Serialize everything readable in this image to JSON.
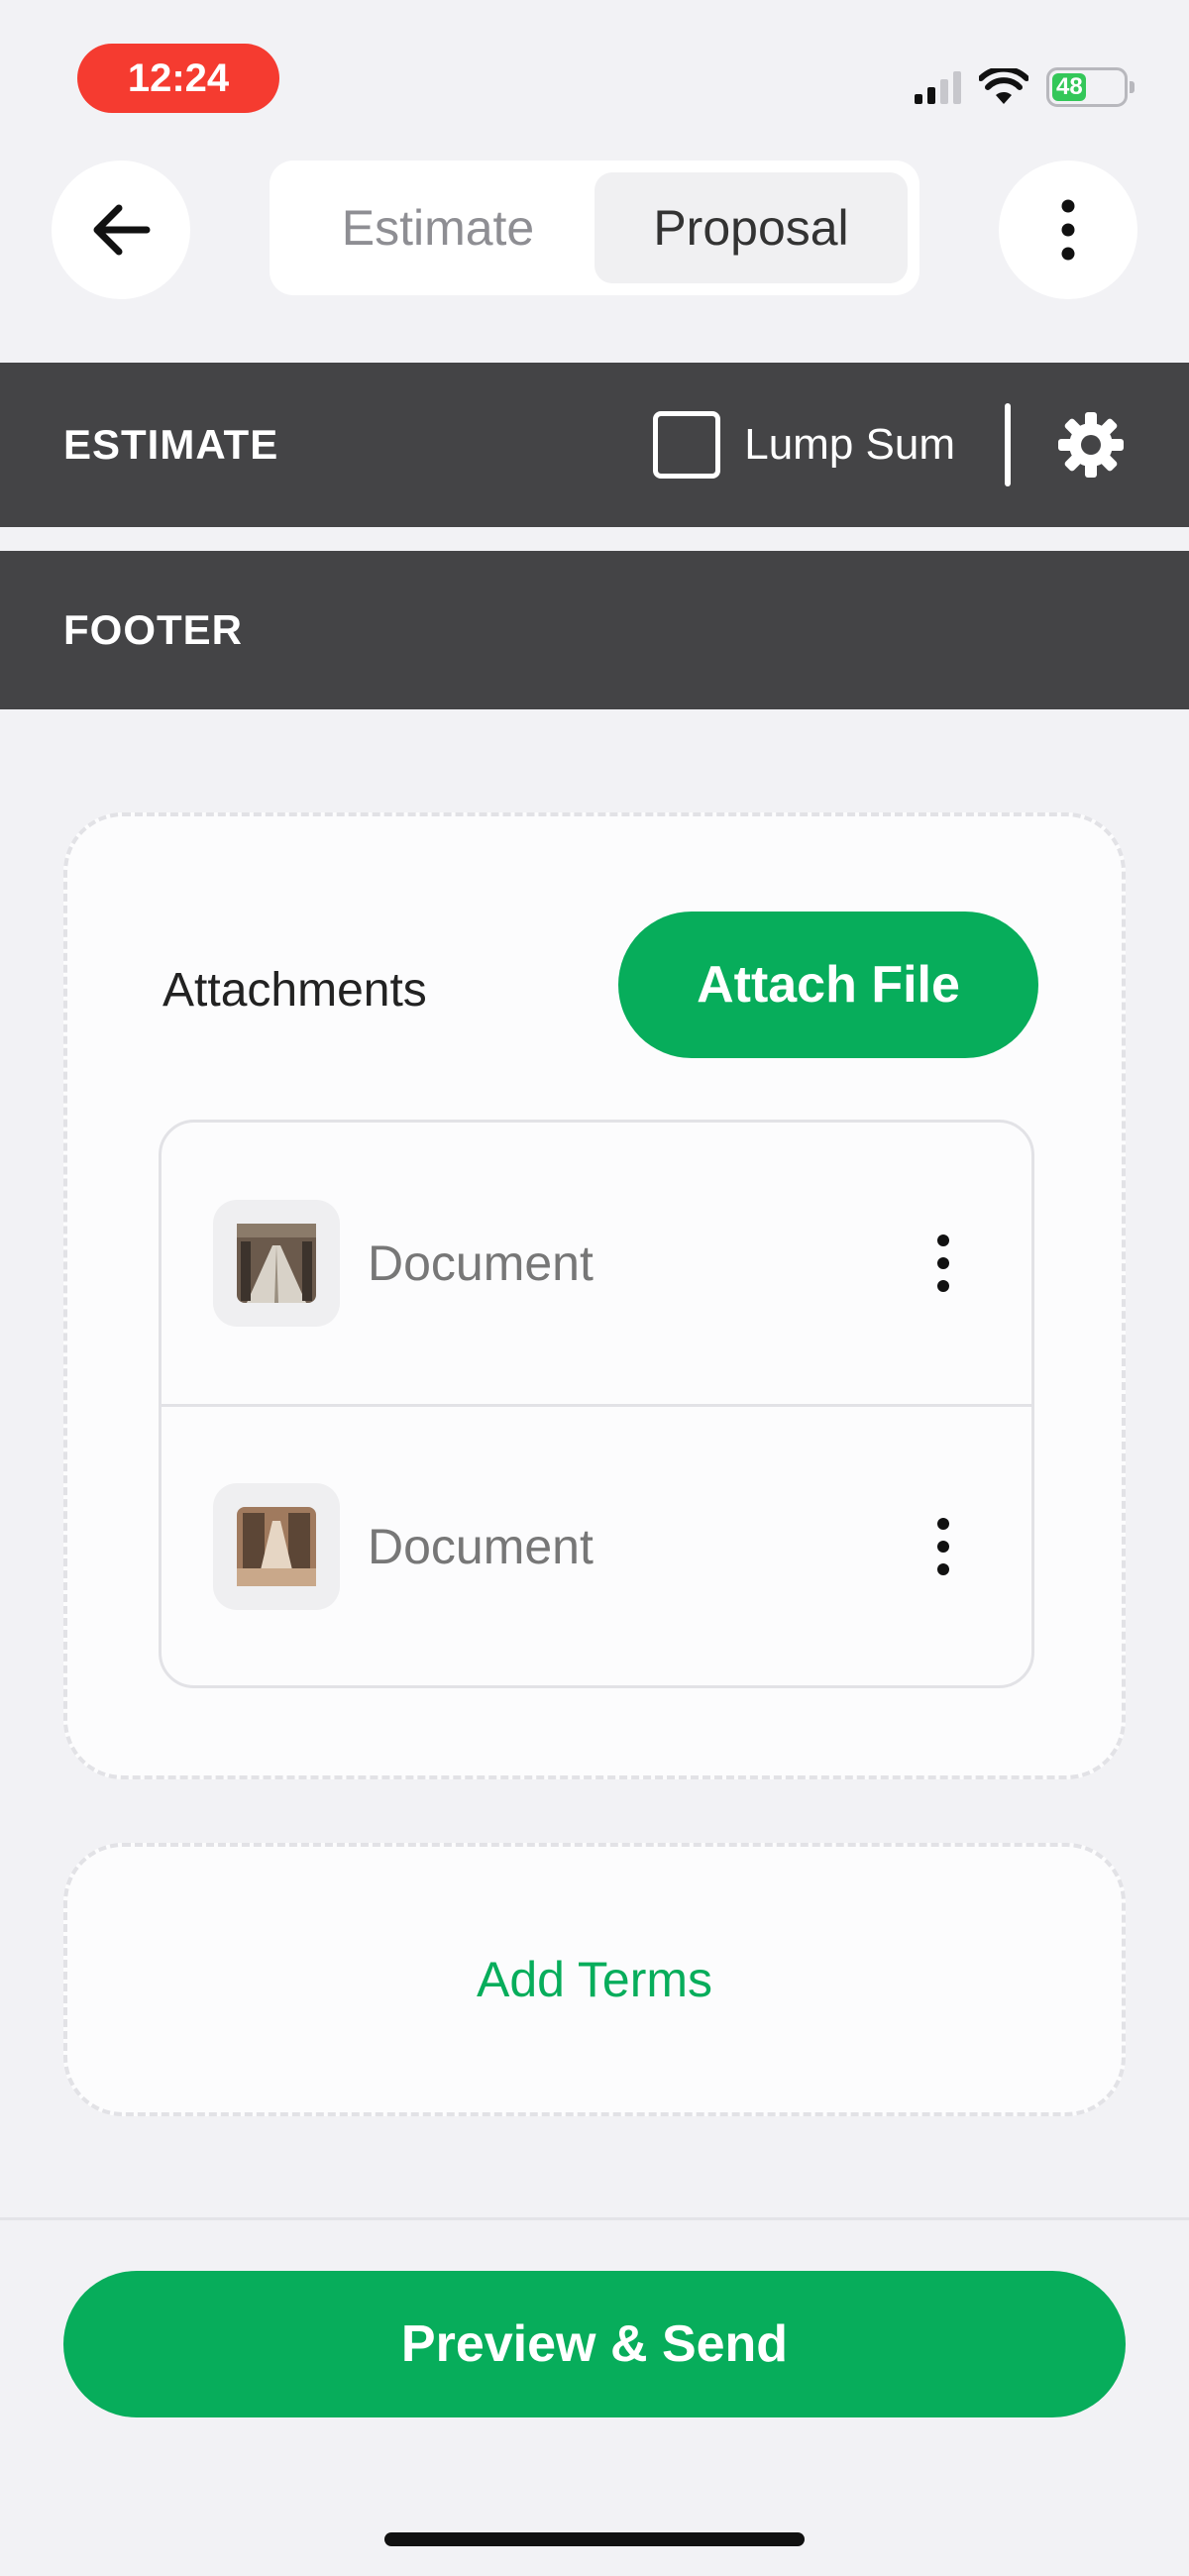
{
  "status_bar": {
    "time": "12:24",
    "battery": "48"
  },
  "nav": {
    "tabs": [
      {
        "label": "Estimate",
        "active": false
      },
      {
        "label": "Proposal",
        "active": true
      }
    ]
  },
  "sections": {
    "estimate_title": "ESTIMATE",
    "lump_sum_label": "Lump Sum",
    "lump_sum_checked": false,
    "footer_title": "FOOTER"
  },
  "attachments": {
    "label": "Attachments",
    "attach_button": "Attach File",
    "items": [
      {
        "name": "Document"
      },
      {
        "name": "Document"
      }
    ]
  },
  "terms": {
    "add_terms_label": "Add Terms"
  },
  "actions": {
    "preview_send": "Preview & Send"
  },
  "colors": {
    "accent": "#07ad5b",
    "section_bar": "#444446",
    "time_pill": "#f53b30",
    "background": "#f2f2f5"
  }
}
